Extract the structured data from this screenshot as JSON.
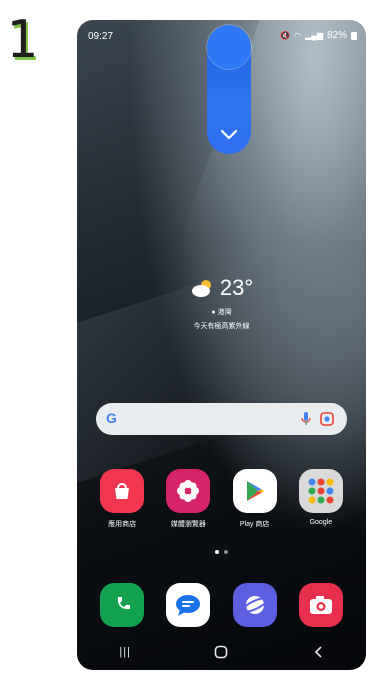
{
  "step": {
    "number": "1"
  },
  "status_bar": {
    "time": "09:27",
    "battery": "82%"
  },
  "weather": {
    "temperature": "23°",
    "location": "港灣",
    "description": "今天有極高紫外線"
  },
  "search": {
    "logo": "G",
    "mic_icon": "mic-icon",
    "lens_icon": "lens-icon"
  },
  "apps": [
    {
      "label": "應用商店",
      "icon": "galaxy-store-icon",
      "color": "#f0374f"
    },
    {
      "label": "媒體瀏覽器",
      "icon": "gallery-flower-icon",
      "color": "#d6246b"
    },
    {
      "label": "Play 商店",
      "icon": "play-store-icon",
      "color": "#ffffff"
    },
    {
      "label": "Google",
      "icon": "google-folder-icon",
      "color": "#d9d9d9"
    }
  ],
  "dock": [
    {
      "icon": "phone-icon",
      "color": "#12a150"
    },
    {
      "icon": "messages-icon",
      "color": "#ffffff"
    },
    {
      "icon": "internet-icon",
      "color": "#5b5fe0"
    },
    {
      "icon": "camera-icon",
      "color": "#e8304e"
    }
  ],
  "nav": {
    "recent": "|||",
    "home": "home-icon",
    "back": "back-icon"
  },
  "colors": {
    "accent": "#2f78f5",
    "step_shadow": "#7cc242"
  }
}
